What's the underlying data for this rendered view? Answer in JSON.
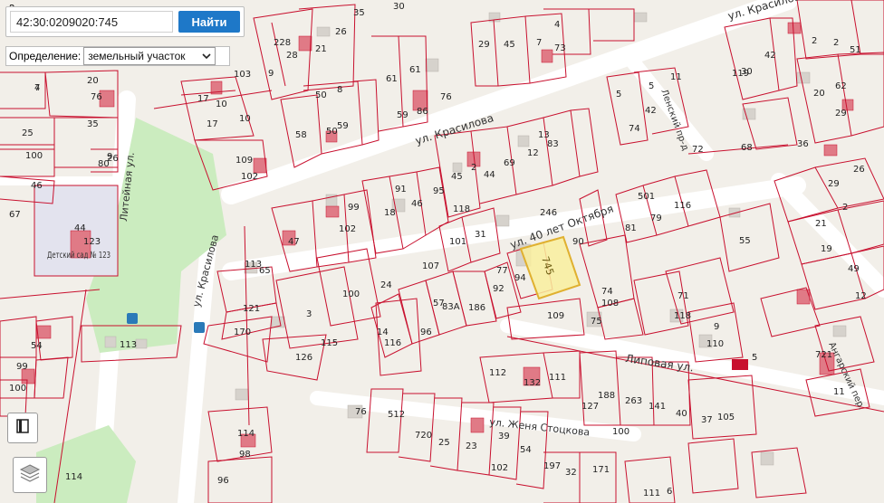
{
  "search": {
    "value": "42:30:0209020:745",
    "button_label": "Найти"
  },
  "definition": {
    "label": "Определение:",
    "selected": "земельный участок"
  },
  "colors": {
    "background": "#f2efe9",
    "parcel": "#c8102e",
    "highlight_fill": "#f9ef9e",
    "highlight_stroke": "#e0b030",
    "green": "#cbecbf",
    "building": "#d6d2cc",
    "road": "#ffffff"
  },
  "highlighted_parcel": "745",
  "streets": [
    {
      "name": "ул. Красилова"
    },
    {
      "name": "ул. 40 лет Октября"
    },
    {
      "name": "ул. Красилова"
    },
    {
      "name": "Литейная ул."
    },
    {
      "name": "ул. Красилова"
    },
    {
      "name": "Ленский пр-д"
    },
    {
      "name": "Липовая ул."
    },
    {
      "name": "ул. Женя Стоцкова"
    },
    {
      "name": "Ангарский пер."
    }
  ],
  "kindergarten_label": "Детский сад № 123",
  "parcel_labels": [
    "3",
    "4",
    "5",
    "7",
    "8",
    "20",
    "76",
    "25",
    "35",
    "100",
    "26",
    "46",
    "67",
    "9",
    "80",
    "44",
    "123",
    "54",
    "99",
    "100",
    "113",
    "114",
    "17",
    "10",
    "17",
    "103",
    "10",
    "109",
    "102",
    "228",
    "28",
    "21",
    "9",
    "26",
    "35",
    "50",
    "58",
    "50",
    "8",
    "59",
    "61",
    "59",
    "61",
    "86",
    "76",
    "30",
    "29",
    "45",
    "7",
    "4",
    "73",
    "11",
    "30",
    "42",
    "5",
    "5",
    "42",
    "74",
    "72",
    "68",
    "36",
    "2",
    "20",
    "2",
    "62",
    "29",
    "51",
    "26",
    "29",
    "2",
    "21",
    "19",
    "49",
    "12",
    "721",
    "11",
    "119",
    "83",
    "13",
    "12",
    "69",
    "2",
    "44",
    "45",
    "95",
    "91",
    "46",
    "18",
    "99",
    "102",
    "47",
    "118",
    "101",
    "31",
    "246",
    "90",
    "81",
    "79",
    "116",
    "501",
    "55",
    "113",
    "65",
    "100",
    "107",
    "24",
    "57",
    "92",
    "94",
    "77",
    "109",
    "108",
    "75",
    "71",
    "118",
    "9",
    "110",
    "5",
    "121",
    "3",
    "170",
    "126",
    "115",
    "14",
    "116",
    "96",
    "83А",
    "186",
    "112",
    "132",
    "111",
    "188",
    "263",
    "141",
    "40",
    "37",
    "105",
    "76",
    "512",
    "720",
    "25",
    "23",
    "39",
    "102",
    "54",
    "197",
    "32",
    "171",
    "114",
    "98",
    "96",
    "74",
    "127",
    "100",
    "111",
    "6",
    "9",
    "8",
    "71",
    "4",
    "6"
  ]
}
